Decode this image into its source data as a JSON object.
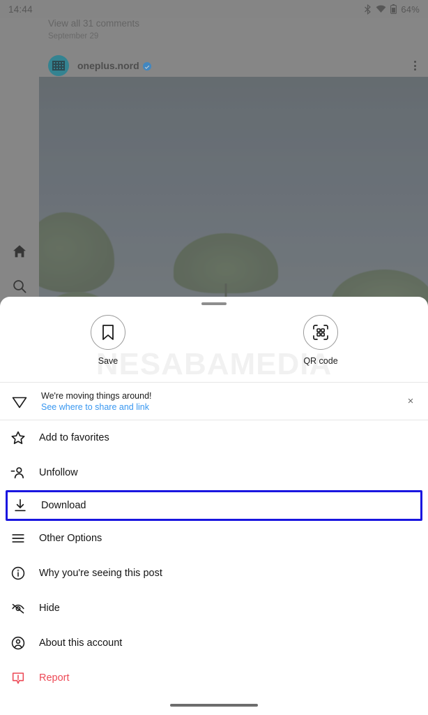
{
  "status_bar": {
    "time": "14:44",
    "battery_text": "64%",
    "icons": [
      "bluetooth-icon",
      "wifi-icon",
      "battery-icon"
    ]
  },
  "background_app": {
    "comments_link": "View all 31 comments",
    "post_date": "September 29",
    "username": "oneplus.nord",
    "verified": true,
    "rail_icons": [
      "home-icon",
      "search-icon"
    ],
    "post_menu": "more-options-icon"
  },
  "watermark": {
    "text": "NESABAMEDIA"
  },
  "sheet": {
    "quick_actions": [
      {
        "id": "save",
        "label": "Save",
        "icon": "bookmark-icon"
      },
      {
        "id": "qr",
        "label": "QR code",
        "icon": "qr-code-icon"
      }
    ],
    "banner": {
      "icon": "paper-plane-icon",
      "title": "We're moving things around!",
      "link": "See where to share and link",
      "close": "×"
    },
    "menu_items": [
      {
        "id": "add-to-favorites",
        "label": "Add to favorites",
        "icon": "star-icon",
        "highlighted": false,
        "danger": false
      },
      {
        "id": "unfollow",
        "label": "Unfollow",
        "icon": "user-minus-icon",
        "highlighted": false,
        "danger": false
      },
      {
        "id": "download",
        "label": "Download",
        "icon": "download-icon",
        "highlighted": true,
        "danger": false
      },
      {
        "id": "other-options",
        "label": "Other Options",
        "icon": "hamburger-icon",
        "highlighted": false,
        "danger": false
      },
      {
        "id": "why-seeing-post",
        "label": "Why you're seeing this post",
        "icon": "info-icon",
        "highlighted": false,
        "danger": false
      },
      {
        "id": "hide",
        "label": "Hide",
        "icon": "eye-off-icon",
        "highlighted": false,
        "danger": false
      },
      {
        "id": "about-this-account",
        "label": "About this account",
        "icon": "account-circle-icon",
        "highlighted": false,
        "danger": false
      },
      {
        "id": "report",
        "label": "Report",
        "icon": "report-icon",
        "highlighted": false,
        "danger": true
      }
    ]
  },
  "colors": {
    "highlight_border": "#1a16e0",
    "link_blue": "#3897f0",
    "danger_red": "#ed4956",
    "sheet_bg": "#ffffff"
  }
}
